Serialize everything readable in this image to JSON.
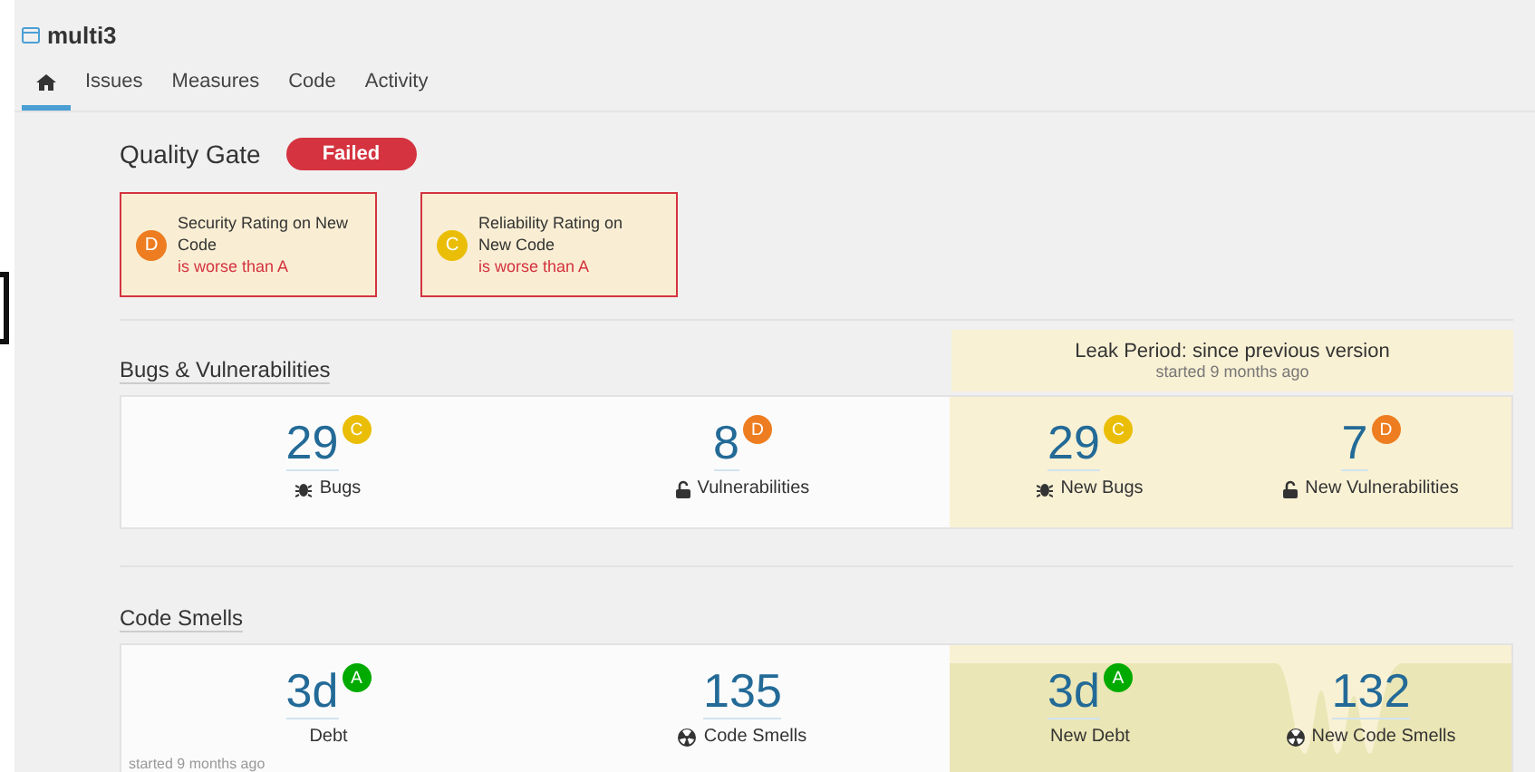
{
  "project": {
    "name": "multi3"
  },
  "tabs": [
    {
      "kind": "home",
      "selected": true
    },
    {
      "label": "Issues",
      "selected": false
    },
    {
      "label": "Measures",
      "selected": false
    },
    {
      "label": "Code",
      "selected": false
    },
    {
      "label": "Activity",
      "selected": false
    }
  ],
  "quality_gate": {
    "title": "Quality Gate",
    "status": "Failed",
    "conditions": [
      {
        "rating": "D",
        "color": "#ed7d20",
        "metric": "Security Rating on New Code",
        "message": "is worse than A"
      },
      {
        "rating": "C",
        "color": "#eabe06",
        "metric": "Reliability Rating on New Code",
        "message": "is worse than A"
      }
    ]
  },
  "leak_period": {
    "title": "Leak Period: since previous version",
    "started": "started 9 months ago"
  },
  "sections": [
    {
      "title_parts": [
        "Bugs & Vulnerabilities"
      ],
      "overall": [
        {
          "value": "29",
          "rating": "C",
          "color": "#eabe06",
          "kind": "bug",
          "label": "Bugs"
        },
        {
          "value": "8",
          "rating": "D",
          "color": "#ed7d20",
          "kind": "lock",
          "label": "Vulnerabilities"
        }
      ],
      "leak": [
        {
          "value": "29",
          "rating": "C",
          "color": "#eabe06",
          "kind": "bug",
          "label": "New Bugs"
        },
        {
          "value": "7",
          "rating": "D",
          "color": "#ed7d20",
          "kind": "lock",
          "label": "New Vulnerabilities"
        }
      ]
    },
    {
      "title_parts": [
        "Code Smells"
      ],
      "footnote": "started 9 months ago",
      "sparkline": true,
      "overall": [
        {
          "value": "3d",
          "rating": "A",
          "color": "#00aa00",
          "label": "Debt"
        },
        {
          "value": "135",
          "kind": "smell",
          "label": "Code Smells"
        }
      ],
      "leak": [
        {
          "value": "3d",
          "rating": "A",
          "color": "#00aa00",
          "label": "New Debt"
        },
        {
          "value": "132",
          "kind": "smell",
          "label": "New Code Smells"
        }
      ]
    }
  ]
}
